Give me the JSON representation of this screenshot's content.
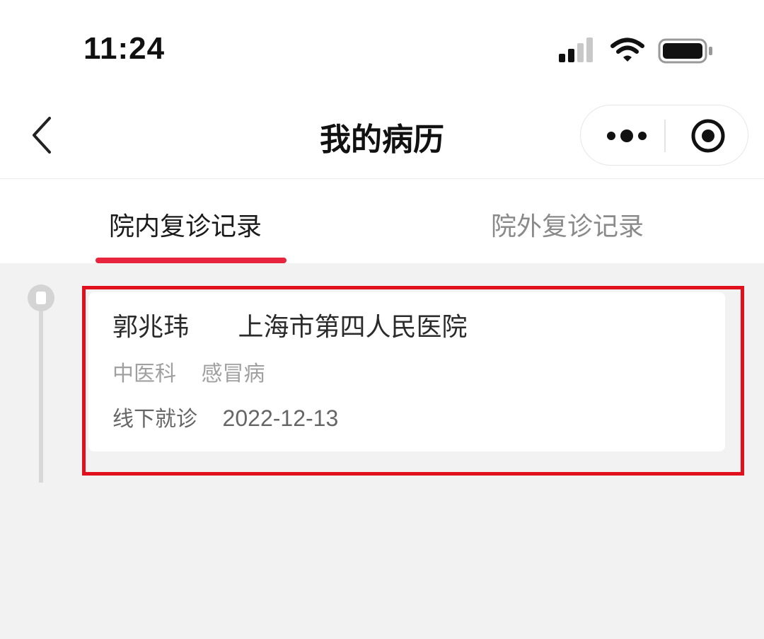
{
  "status_bar": {
    "time": "11:24",
    "icons": [
      "cellular-signal-icon",
      "wifi-icon",
      "battery-icon"
    ]
  },
  "nav": {
    "title": "我的病历",
    "icons": [
      "back-chevron-icon",
      "more-dots-icon",
      "close-target-icon"
    ]
  },
  "tabs": [
    {
      "label": "院内复诊记录",
      "active": true
    },
    {
      "label": "院外复诊记录",
      "active": false
    }
  ],
  "records": [
    {
      "doctor": "郭兆玮",
      "hospital": "上海市第四人民医院",
      "department": "中医科",
      "diagnosis": "感冒病",
      "visit_type": "线下就诊",
      "date": "2022-12-13"
    }
  ],
  "colors": {
    "accent": "#e8253c",
    "highlight": "#e0101c",
    "background": "#f2f2f2",
    "card": "#ffffff"
  }
}
